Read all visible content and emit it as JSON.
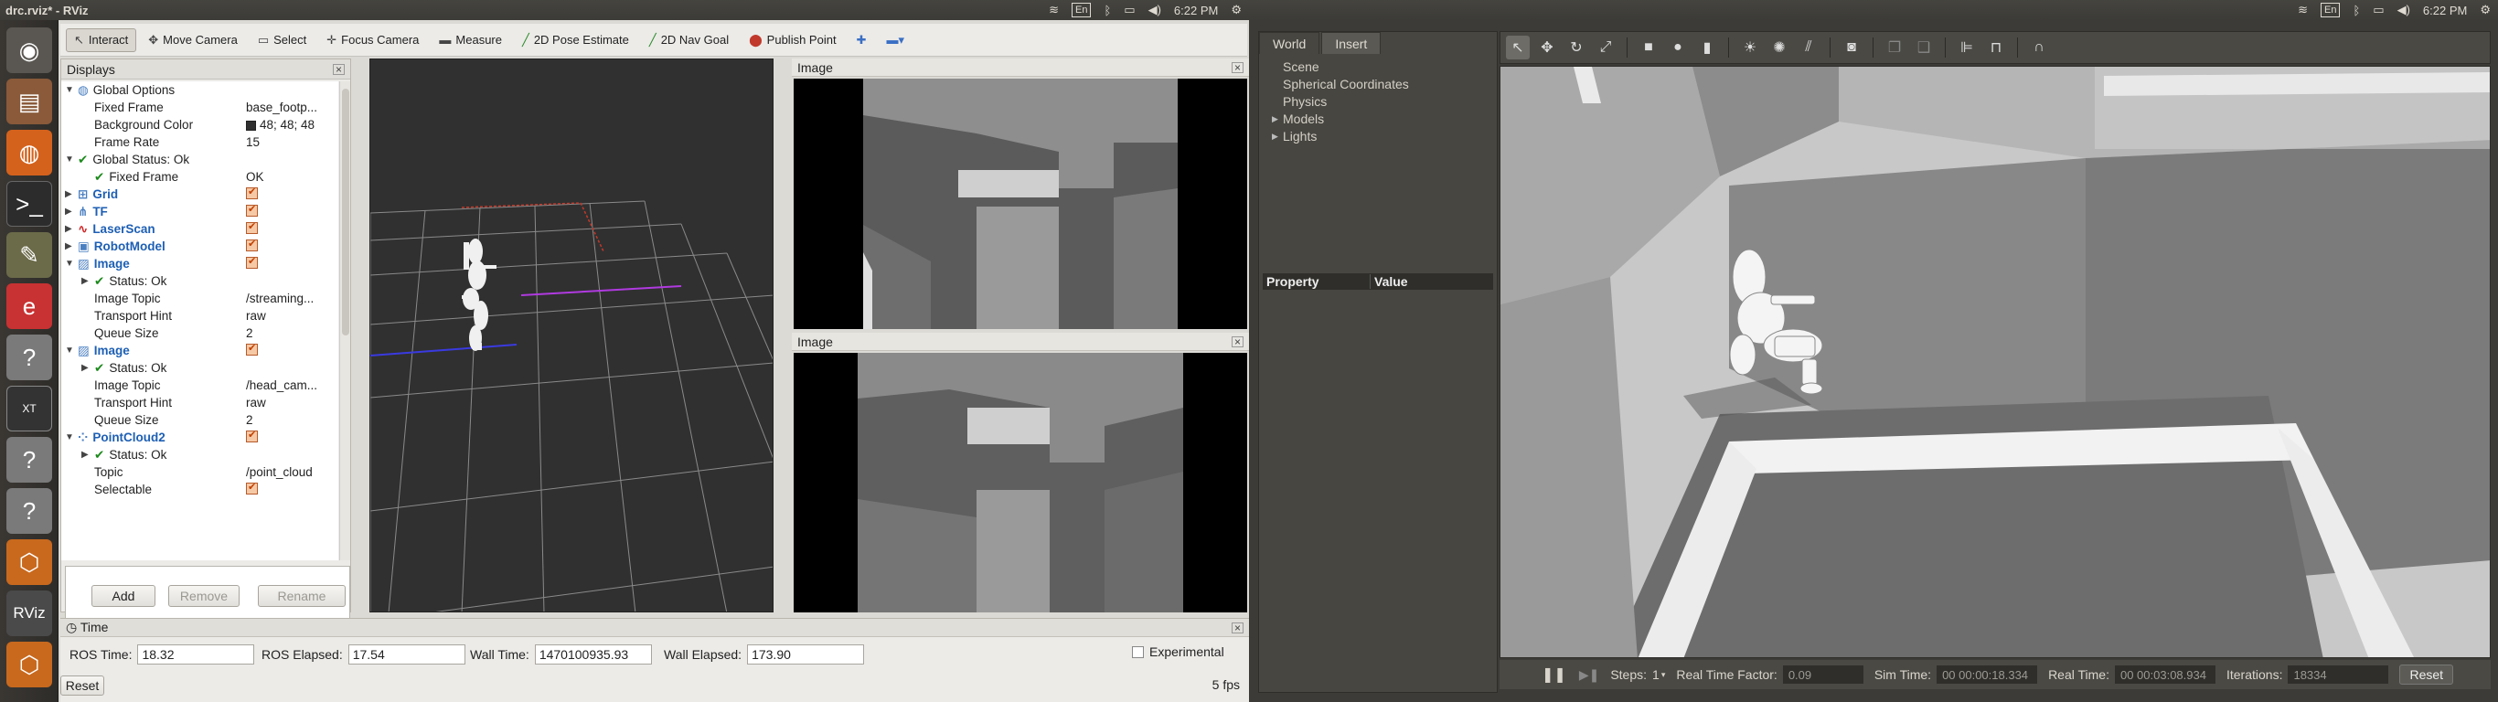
{
  "rviz": {
    "window_title": "drc.rviz* - RViz",
    "clock": "6:22 PM",
    "keyboard": "En",
    "toolbar": [
      {
        "label": "Interact",
        "icon": "interact-icon"
      },
      {
        "label": "Move Camera",
        "icon": "move-camera-icon"
      },
      {
        "label": "Select",
        "icon": "select-icon"
      },
      {
        "label": "Focus Camera",
        "icon": "focus-camera-icon"
      },
      {
        "label": "Measure",
        "icon": "measure-icon"
      },
      {
        "label": "2D Pose Estimate",
        "icon": "pose-estimate-icon"
      },
      {
        "label": "2D Nav Goal",
        "icon": "nav-goal-icon"
      },
      {
        "label": "Publish Point",
        "icon": "publish-point-icon"
      }
    ],
    "displays": {
      "title": "Displays",
      "rows": [
        {
          "name": "Global Options",
          "value": ""
        },
        {
          "name": "Fixed Frame",
          "value": "base_footp..."
        },
        {
          "name": "Background Color",
          "value": "48; 48; 48"
        },
        {
          "name": "Frame Rate",
          "value": "15"
        },
        {
          "name": "Global Status: Ok",
          "value": ""
        },
        {
          "name": "Fixed Frame",
          "value": "OK"
        },
        {
          "name": "Grid",
          "value": ""
        },
        {
          "name": "TF",
          "value": ""
        },
        {
          "name": "LaserScan",
          "value": ""
        },
        {
          "name": "RobotModel",
          "value": ""
        },
        {
          "name": "Image",
          "value": ""
        },
        {
          "name": "Status: Ok",
          "value": ""
        },
        {
          "name": "Image Topic",
          "value": "/streaming..."
        },
        {
          "name": "Transport Hint",
          "value": "raw"
        },
        {
          "name": "Queue Size",
          "value": "2"
        },
        {
          "name": "Image",
          "value": ""
        },
        {
          "name": "Status: Ok",
          "value": ""
        },
        {
          "name": "Image Topic",
          "value": "/head_cam..."
        },
        {
          "name": "Transport Hint",
          "value": "raw"
        },
        {
          "name": "Queue Size",
          "value": "2"
        },
        {
          "name": "PointCloud2",
          "value": ""
        },
        {
          "name": "Status: Ok",
          "value": ""
        },
        {
          "name": "Topic",
          "value": "/point_cloud"
        },
        {
          "name": "Selectable",
          "value": ""
        }
      ],
      "buttons": {
        "add": "Add",
        "remove": "Remove",
        "rename": "Rename"
      }
    },
    "image_panels": [
      {
        "title": "Image"
      },
      {
        "title": "Image"
      }
    ],
    "time": {
      "title": "Time",
      "ros_time_label": "ROS Time:",
      "ros_time": "18.32",
      "ros_elapsed_label": "ROS Elapsed:",
      "ros_elapsed": "17.54",
      "wall_time_label": "Wall Time:",
      "wall_time": "1470100935.93",
      "wall_elapsed_label": "Wall Elapsed:",
      "wall_elapsed": "173.90",
      "experimental": "Experimental",
      "reset": "Reset",
      "fps": "5 fps"
    }
  },
  "gazebo": {
    "clock": "6:22 PM",
    "keyboard": "En",
    "tabs": [
      "World",
      "Insert"
    ],
    "tree": [
      "Scene",
      "Spherical Coordinates",
      "Physics",
      "Models",
      "Lights"
    ],
    "prop_headers": {
      "property": "Property",
      "value": "Value"
    },
    "bottom": {
      "steps_label": "Steps:",
      "steps": "1",
      "rtf_label": "Real Time Factor:",
      "rtf": "0.09",
      "sim_time_label": "Sim Time:",
      "sim_time": "00 00:00:18.334",
      "real_time_label": "Real Time:",
      "real_time": "00 00:03:08.934",
      "iterations_label": "Iterations:",
      "iterations": "18334",
      "reset": "Reset"
    }
  }
}
